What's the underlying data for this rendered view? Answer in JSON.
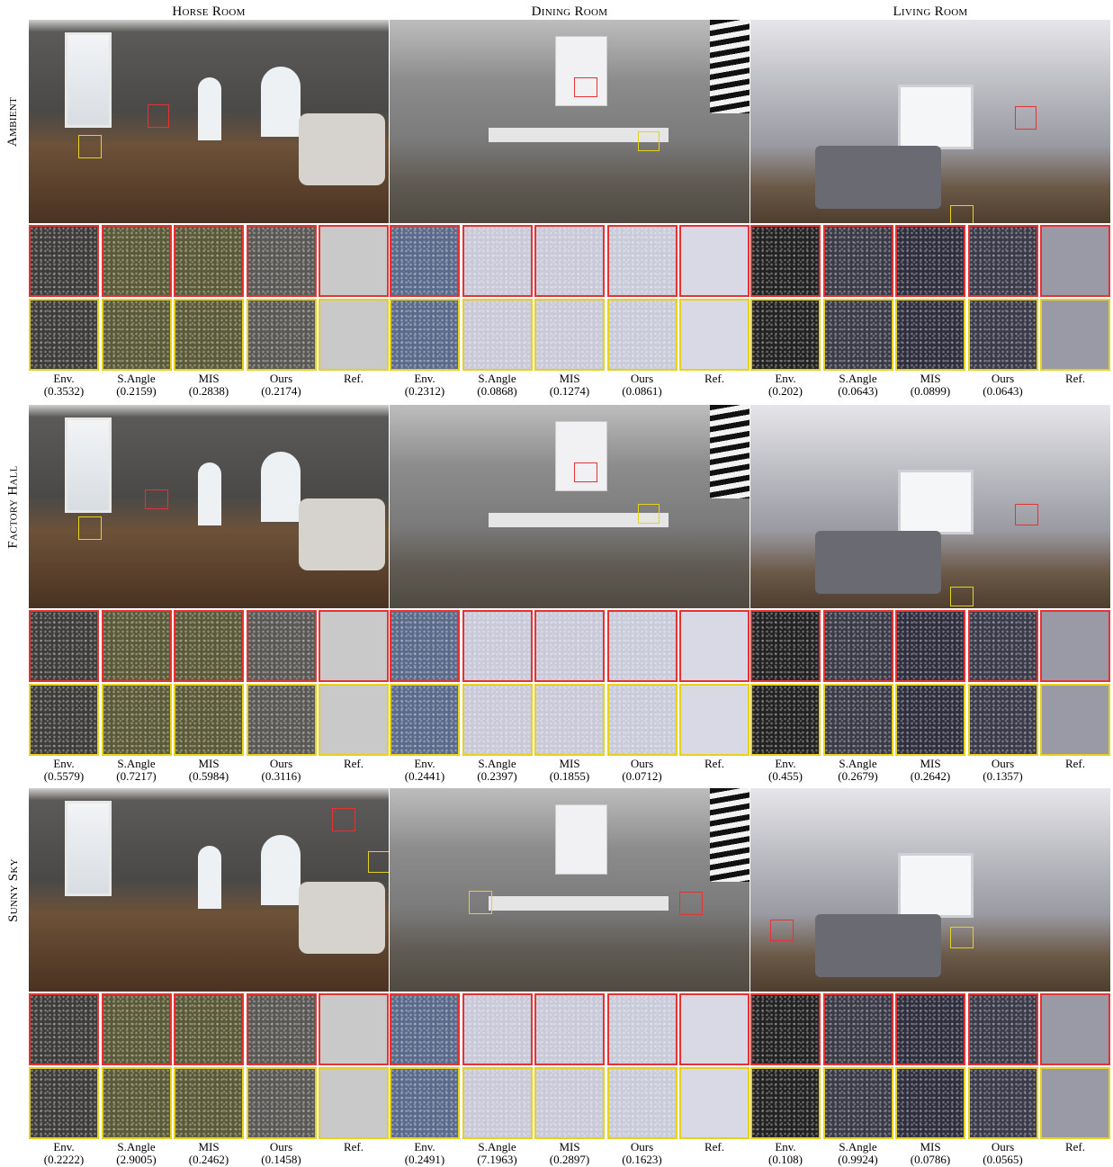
{
  "columns": [
    "Horse Room",
    "Dining Room",
    "Living Room"
  ],
  "rows": [
    {
      "name": "Ambient",
      "groups": [
        {
          "labels": [
            {
              "m": "Env.",
              "v": "(0.3532)"
            },
            {
              "m": "S.Angle",
              "v": "(0.2159)"
            },
            {
              "m": "MIS",
              "v": "(0.2838)"
            },
            {
              "m": "Ours",
              "v": "(0.2174)"
            },
            {
              "m": "Ref.",
              "v": ""
            }
          ]
        },
        {
          "labels": [
            {
              "m": "Env.",
              "v": "(0.2312)"
            },
            {
              "m": "S.Angle",
              "v": "(0.0868)"
            },
            {
              "m": "MIS",
              "v": "(0.1274)"
            },
            {
              "m": "Ours",
              "v": "(0.0861)"
            },
            {
              "m": "Ref.",
              "v": ""
            }
          ]
        },
        {
          "labels": [
            {
              "m": "Env.",
              "v": "(0.202)"
            },
            {
              "m": "S.Angle",
              "v": "(0.0643)"
            },
            {
              "m": "MIS",
              "v": "(0.0899)"
            },
            {
              "m": "Ours",
              "v": "(0.0643)"
            },
            {
              "m": "Ref.",
              "v": ""
            }
          ]
        }
      ]
    },
    {
      "name": "Factory Hall",
      "groups": [
        {
          "labels": [
            {
              "m": "Env.",
              "v": "(0.5579)"
            },
            {
              "m": "S.Angle",
              "v": "(0.7217)"
            },
            {
              "m": "MIS",
              "v": "(0.5984)"
            },
            {
              "m": "Ours",
              "v": "(0.3116)"
            },
            {
              "m": "Ref.",
              "v": ""
            }
          ]
        },
        {
          "labels": [
            {
              "m": "Env.",
              "v": "(0.2441)"
            },
            {
              "m": "S.Angle",
              "v": "(0.2397)"
            },
            {
              "m": "MIS",
              "v": "(0.1855)"
            },
            {
              "m": "Ours",
              "v": "(0.0712)"
            },
            {
              "m": "Ref.",
              "v": ""
            }
          ]
        },
        {
          "labels": [
            {
              "m": "Env.",
              "v": "(0.455)"
            },
            {
              "m": "S.Angle",
              "v": "(0.2679)"
            },
            {
              "m": "MIS",
              "v": "(0.2642)"
            },
            {
              "m": "Ours",
              "v": "(0.1357)"
            },
            {
              "m": "Ref.",
              "v": ""
            }
          ]
        }
      ]
    },
    {
      "name": "Sunny Sky",
      "groups": [
        {
          "labels": [
            {
              "m": "Env.",
              "v": "(0.2222)"
            },
            {
              "m": "S.Angle",
              "v": "(2.9005)"
            },
            {
              "m": "MIS",
              "v": "(0.2462)"
            },
            {
              "m": "Ours",
              "v": "(0.1458)"
            },
            {
              "m": "Ref.",
              "v": ""
            }
          ]
        },
        {
          "labels": [
            {
              "m": "Env.",
              "v": "(0.2491)"
            },
            {
              "m": "S.Angle",
              "v": "(7.1963)"
            },
            {
              "m": "MIS",
              "v": "(0.2897)"
            },
            {
              "m": "Ours",
              "v": "(0.1623)"
            },
            {
              "m": "Ref.",
              "v": ""
            }
          ]
        },
        {
          "labels": [
            {
              "m": "Env.",
              "v": "(0.108)"
            },
            {
              "m": "S.Angle",
              "v": "(0.9924)"
            },
            {
              "m": "MIS",
              "v": "(0.0786)"
            },
            {
              "m": "Ours",
              "v": "(0.0565)"
            },
            {
              "m": "Ref.",
              "v": ""
            }
          ]
        }
      ]
    }
  ],
  "colors": {
    "red_crop": "#e53232",
    "yellow_crop": "#e6d21e"
  }
}
